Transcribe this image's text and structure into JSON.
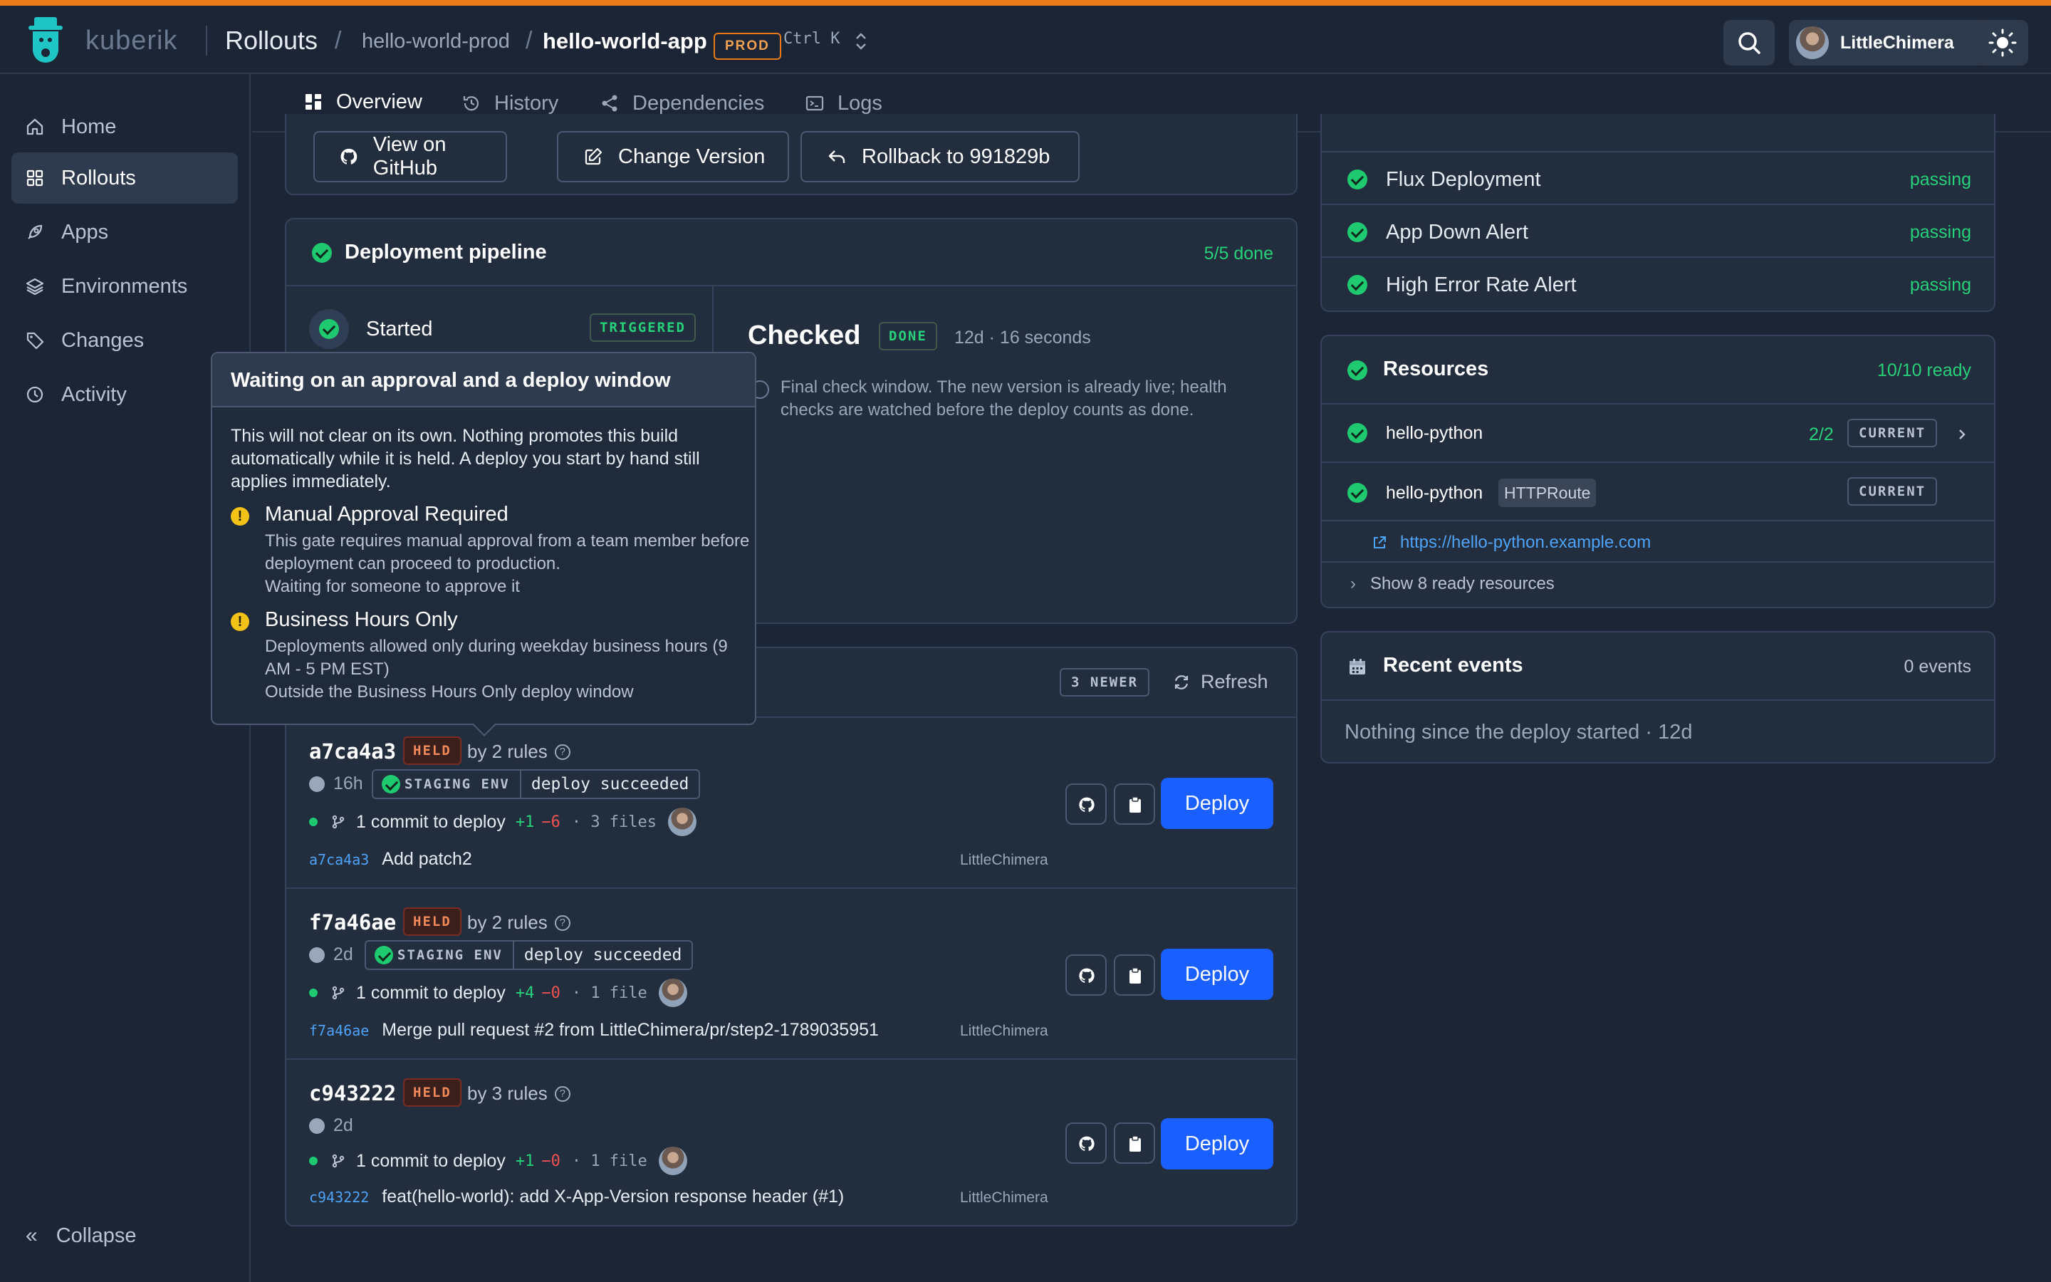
{
  "header": {
    "brand": "kuberik",
    "section": "Rollouts",
    "environment": "hello-world-prod",
    "app": "hello-world-app",
    "env_badge": "PROD",
    "shortcut": "Ctrl K",
    "user": "LittleChimera",
    "accent_color": "#e97a17"
  },
  "sidebar": {
    "items": [
      {
        "label": "Home",
        "icon": "home-icon"
      },
      {
        "label": "Rollouts",
        "icon": "grid-icon",
        "active": true
      },
      {
        "label": "Apps",
        "icon": "rocket-icon"
      },
      {
        "label": "Environments",
        "icon": "layers-icon"
      },
      {
        "label": "Changes",
        "icon": "tag-icon"
      },
      {
        "label": "Activity",
        "icon": "clock-icon"
      }
    ],
    "collapse": "Collapse"
  },
  "tabs": [
    {
      "label": "Overview",
      "active": true
    },
    {
      "label": "History"
    },
    {
      "label": "Dependencies"
    },
    {
      "label": "Logs"
    }
  ],
  "actions": {
    "github": "View on GitHub",
    "change_version": "Change Version",
    "rollback": "Rollback to 991829b"
  },
  "pipeline": {
    "title": "Deployment pipeline",
    "progress": "5/5 done",
    "started_label": "Started",
    "started_badge": "TRIGGERED",
    "checked_title": "Checked",
    "checked_badge": "DONE",
    "checked_meta": "12d · 16 seconds",
    "checked_desc": "Final check window. The new version is already live; health checks are watched before the deploy counts as done."
  },
  "tooltip": {
    "title": "Waiting on an approval and a deploy window",
    "body": "This will not clear on its own. Nothing promotes this build automatically while it is held. A deploy you start by hand still applies immediately.",
    "rules": [
      {
        "name": "Manual Approval Required",
        "desc": "This gate requires manual approval from a team member before deployment can proceed to production.",
        "status": "Waiting for someone to approve it"
      },
      {
        "name": "Business Hours Only",
        "desc": "Deployments allowed only during weekday business hours (9 AM - 5 PM EST)",
        "status": "Outside the Business Hours Only deploy window"
      }
    ]
  },
  "candidates": {
    "newer_badge": "3 NEWER",
    "refresh": "Refresh",
    "held_label": "HELD",
    "deploy_label": "Deploy",
    "rows": [
      {
        "sha": "a7ca4a3",
        "rules": "by 2 rules",
        "age": "16h",
        "staging_env": "STAGING ENV",
        "staging_result": "deploy succeeded",
        "commits": "1 commit to deploy",
        "additions": "+1",
        "deletions": "−6",
        "files": "· 3 files",
        "msg_sha": "a7ca4a3",
        "message": "Add patch2",
        "author": "LittleChimera"
      },
      {
        "sha": "f7a46ae",
        "rules": "by 2 rules",
        "age": "2d",
        "staging_env": "STAGING ENV",
        "staging_result": "deploy succeeded",
        "commits": "1 commit to deploy",
        "additions": "+4",
        "deletions": "−0",
        "files": "· 1 file",
        "msg_sha": "f7a46ae",
        "message": "Merge pull request #2 from LittleChimera/pr/step2-1789035951",
        "author": "LittleChimera"
      },
      {
        "sha": "c943222",
        "rules": "by 3 rules",
        "age": "2d",
        "staging_env": "",
        "staging_result": "",
        "commits": "1 commit to deploy",
        "additions": "+1",
        "deletions": "−0",
        "files": "· 1 file",
        "msg_sha": "c943222",
        "message": "feat(hello-world): add X-App-Version response header (#1)",
        "author": "LittleChimera"
      }
    ]
  },
  "checks": [
    {
      "name": "Flux Deployment",
      "status": "passing"
    },
    {
      "name": "App Down Alert",
      "status": "passing"
    },
    {
      "name": "High Error Rate Alert",
      "status": "passing"
    }
  ],
  "resources": {
    "title": "Resources",
    "ready": "10/10 ready",
    "items": [
      {
        "name": "hello-python",
        "count": "2/2",
        "badge": "CURRENT"
      },
      {
        "name": "hello-python",
        "kind": "HTTPRoute",
        "badge": "CURRENT"
      }
    ],
    "url": "https://hello-python.example.com",
    "show_more": "Show 8 ready resources"
  },
  "events": {
    "title": "Recent events",
    "count": "0 events",
    "empty": "Nothing since the deploy started · 12d"
  }
}
